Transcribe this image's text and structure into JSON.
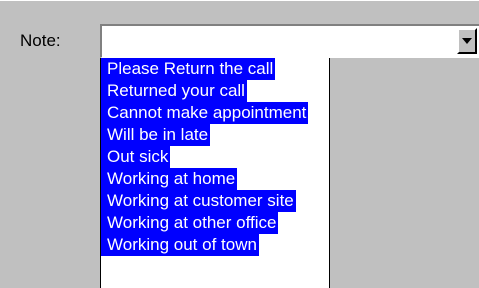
{
  "form": {
    "note_label": "Note:",
    "note_value": ""
  },
  "dropdown": {
    "items": [
      "Please Return the call",
      "Returned your call",
      "Cannot make appointment",
      "Will be in late",
      "Out sick",
      "Working at home",
      "Working at customer site",
      "Working at other office",
      "Working out of town"
    ]
  },
  "icons": {
    "combo_button": "chevron-down-icon"
  },
  "colors": {
    "background": "#c0c0c0",
    "highlight": "#0000ff",
    "highlight_text": "#ffffff"
  }
}
